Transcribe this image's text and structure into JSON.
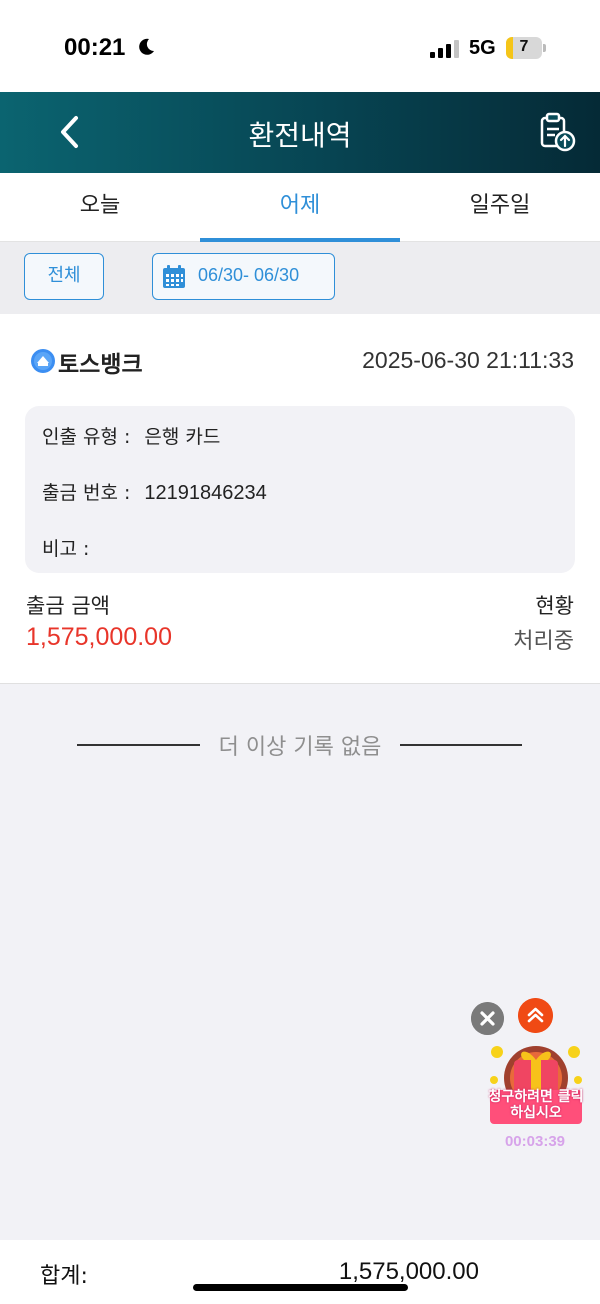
{
  "status_bar": {
    "time": "00:21",
    "network": "5G",
    "battery": "7",
    "battery_level_percent": 7
  },
  "header": {
    "title": "환전내역",
    "back_icon": "chevron-left-icon",
    "export_icon": "clipboard-upload-icon"
  },
  "tabs": [
    {
      "label": "오늘",
      "active": false
    },
    {
      "label": "어제",
      "active": true
    },
    {
      "label": "일주일",
      "active": false
    }
  ],
  "filters": {
    "all_label": "전체",
    "date_range": "06/30- 06/30",
    "calendar_icon": "calendar-icon"
  },
  "record": {
    "bank_name": "토스뱅크",
    "datetime": "2025-06-30 21:11:33",
    "details": [
      {
        "label": "인출 유형 :",
        "value": "은행 카드"
      },
      {
        "label": "출금 번호 :",
        "value": "12191846234"
      },
      {
        "label": "비고 :",
        "value": ""
      }
    ],
    "amount_label": "출금 금액",
    "amount_value": "1,575,000.00",
    "status_label": "현황",
    "status_value": "처리중"
  },
  "end_message": "더 이상 기록 없음",
  "floating": {
    "gift_text": "청구하려면 클릭하십시오",
    "timer": "00:03:39",
    "close_icon": "close-icon",
    "up_icon": "double-chevron-up-icon"
  },
  "footer": {
    "total_label": "합계:",
    "total_value": "1,575,000.00"
  },
  "colors": {
    "accent": "#2f8fd8",
    "amount": "#e8352a",
    "header_start": "#0b6470",
    "header_end": "#052a36"
  }
}
